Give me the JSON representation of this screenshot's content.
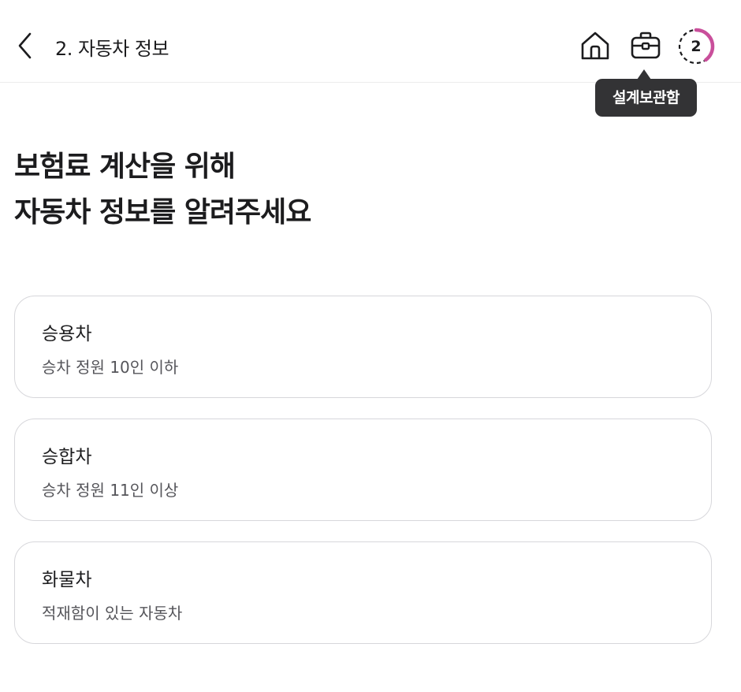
{
  "header": {
    "title": "2. 자동차 정보",
    "progress_step": "2",
    "progress_fraction": 0.4,
    "progress_color": "#c94f9b"
  },
  "tooltip": {
    "label": "설계보관함"
  },
  "headline": {
    "line1": "보험료 계산을 위해",
    "line2": "자동차 정보를 알려주세요"
  },
  "options": [
    {
      "title": "승용차",
      "description": "승차 정원 10인 이하"
    },
    {
      "title": "승합차",
      "description": "승차 정원 11인 이상"
    },
    {
      "title": "화물차",
      "description": "적재함이 있는 자동차"
    }
  ],
  "icons": {
    "back": "chevron-left-icon",
    "home": "home-icon",
    "briefcase": "briefcase-icon"
  }
}
